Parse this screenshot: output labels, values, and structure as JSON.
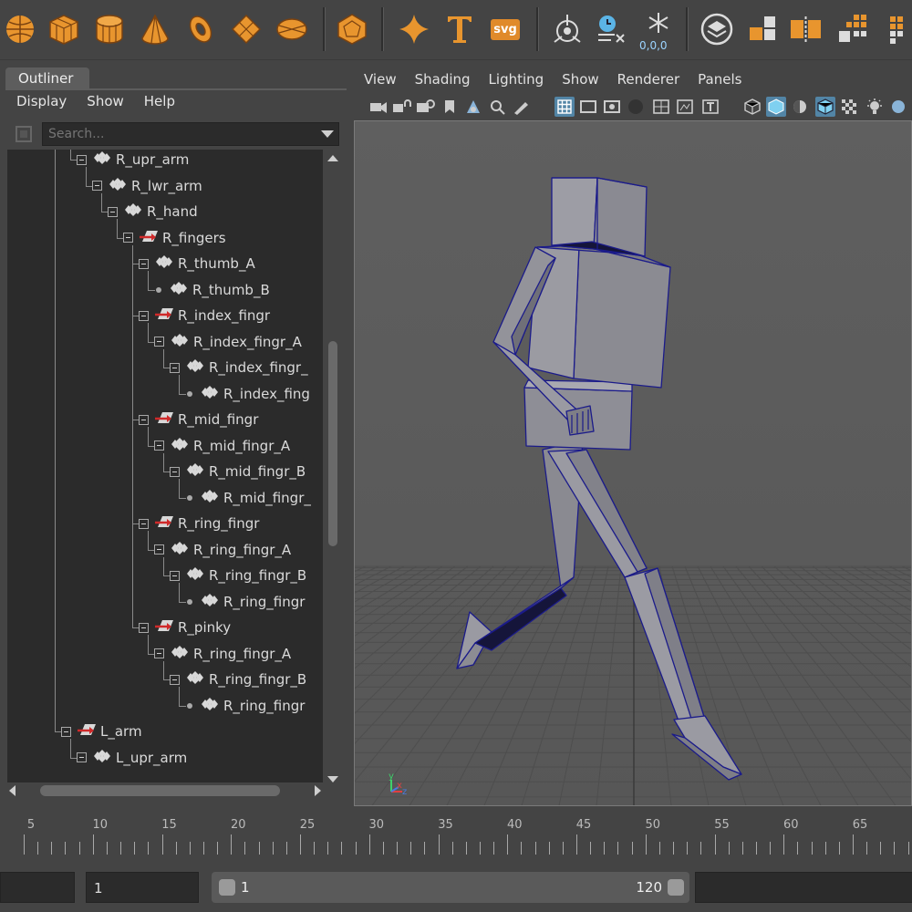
{
  "shelf": {
    "icons": [
      "sphere-icon",
      "cube-icon",
      "cylinder-icon",
      "cone-icon",
      "torus-icon",
      "plane-icon",
      "disc-icon",
      "platonic-icon",
      "super-shape-icon",
      "text-icon",
      "svg-icon",
      "center-pivot-icon",
      "history-icon",
      "freeze-transform-icon",
      "layers-icon",
      "combine-icon",
      "extract-icon",
      "grid-icon",
      "more-icon"
    ],
    "svg_label": "svg",
    "origin_label": "0,0,0"
  },
  "outliner": {
    "tab_label": "Outliner",
    "menu": [
      "Display",
      "Show",
      "Help"
    ],
    "search_placeholder": "Search...",
    "rows": [
      {
        "label": "R_upr_arm",
        "depth": 0,
        "kind": "joint",
        "expand": true
      },
      {
        "label": "R_lwr_arm",
        "depth": 1,
        "kind": "joint",
        "expand": true
      },
      {
        "label": "R_hand",
        "depth": 2,
        "kind": "joint",
        "expand": true
      },
      {
        "label": "R_fingers",
        "depth": 3,
        "kind": "group",
        "expand": true
      },
      {
        "label": "R_thumb_A",
        "depth": 4,
        "kind": "joint",
        "expand": true
      },
      {
        "label": "R_thumb_B",
        "depth": 5,
        "kind": "joint",
        "expand": false
      },
      {
        "label": "R_index_fingr",
        "depth": 4,
        "kind": "group",
        "expand": true
      },
      {
        "label": "R_index_fingr_A",
        "depth": 5,
        "kind": "joint",
        "expand": true
      },
      {
        "label": "R_index_fingr_",
        "depth": 6,
        "kind": "joint",
        "expand": true
      },
      {
        "label": "R_index_fing",
        "depth": 7,
        "kind": "joint",
        "expand": false
      },
      {
        "label": "R_mid_fingr",
        "depth": 4,
        "kind": "group",
        "expand": true
      },
      {
        "label": "R_mid_fingr_A",
        "depth": 5,
        "kind": "joint",
        "expand": true
      },
      {
        "label": "R_mid_fingr_B",
        "depth": 6,
        "kind": "joint",
        "expand": true
      },
      {
        "label": "R_mid_fingr_",
        "depth": 7,
        "kind": "joint",
        "expand": false
      },
      {
        "label": "R_ring_fingr",
        "depth": 4,
        "kind": "group",
        "expand": true
      },
      {
        "label": "R_ring_fingr_A",
        "depth": 5,
        "kind": "joint",
        "expand": true
      },
      {
        "label": "R_ring_fingr_B",
        "depth": 6,
        "kind": "joint",
        "expand": true
      },
      {
        "label": "R_ring_fingr",
        "depth": 7,
        "kind": "joint",
        "expand": false
      },
      {
        "label": "R_pinky",
        "depth": 4,
        "kind": "group",
        "expand": true
      },
      {
        "label": "R_ring_fingr_A",
        "depth": 5,
        "kind": "joint",
        "expand": true
      },
      {
        "label": "R_ring_fingr_B",
        "depth": 6,
        "kind": "joint",
        "expand": true
      },
      {
        "label": "R_ring_fingr",
        "depth": 7,
        "kind": "joint",
        "expand": false
      },
      {
        "label": "L_arm",
        "depth": -1,
        "kind": "group",
        "expand": true
      },
      {
        "label": "L_upr_arm",
        "depth": 0,
        "kind": "joint",
        "expand": true
      }
    ]
  },
  "viewport": {
    "menu": [
      "View",
      "Shading",
      "Lighting",
      "Show",
      "Renderer",
      "Panels"
    ],
    "axis_labels": {
      "x": "x",
      "y": "y",
      "z": "z"
    }
  },
  "timeline": {
    "ticks": [
      "5",
      "10",
      "15",
      "20",
      "25",
      "30",
      "35",
      "40",
      "45",
      "50",
      "55",
      "60",
      "65"
    ],
    "current_frame": "1",
    "range_start": "1",
    "range_end": "120"
  },
  "colors": {
    "accent_blue": "#5285a6",
    "icon_orange": "#e08a2a",
    "wire_blue": "#1b1b8a",
    "mesh_grey": "#8f8f96"
  }
}
